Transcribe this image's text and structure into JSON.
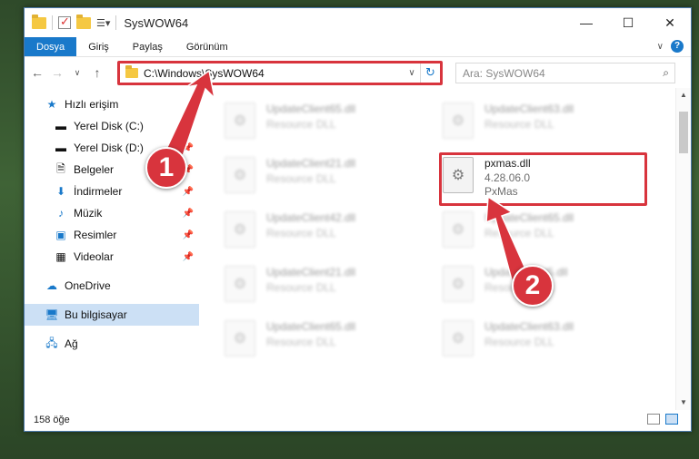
{
  "window": {
    "title": "SysWOW64",
    "caption_buttons": [
      "minimize-icon",
      "maximize-icon",
      "close-icon"
    ]
  },
  "ribbon": {
    "tabs": [
      {
        "label": "Dosya",
        "active": true
      },
      {
        "label": "Giriş",
        "active": false
      },
      {
        "label": "Paylaş",
        "active": false
      },
      {
        "label": "Görünüm",
        "active": false
      }
    ]
  },
  "address": {
    "path": "C:\\Windows\\SysWOW64",
    "search_placeholder": "Ara: SysWOW64"
  },
  "sidebar": {
    "items": [
      {
        "label": "Hızlı erişim",
        "icon": "star-icon",
        "pinned": false,
        "selected": false
      },
      {
        "label": "Yerel Disk (C:)",
        "icon": "drive-icon",
        "pinned": true,
        "selected": false
      },
      {
        "label": "Yerel Disk (D:)",
        "icon": "drive-icon",
        "pinned": true,
        "selected": false
      },
      {
        "label": "Belgeler",
        "icon": "documents-icon",
        "pinned": true,
        "selected": false
      },
      {
        "label": "İndirmeler",
        "icon": "download-icon",
        "pinned": true,
        "selected": false
      },
      {
        "label": "Müzik",
        "icon": "music-icon",
        "pinned": true,
        "selected": false
      },
      {
        "label": "Resimler",
        "icon": "pictures-icon",
        "pinned": true,
        "selected": false
      },
      {
        "label": "Videolar",
        "icon": "video-icon",
        "pinned": true,
        "selected": false
      },
      {
        "label": "OneDrive",
        "icon": "cloud-icon",
        "pinned": false,
        "selected": false
      },
      {
        "label": "Bu bilgisayar",
        "icon": "computer-icon",
        "pinned": false,
        "selected": true
      },
      {
        "label": "Ağ",
        "icon": "network-icon",
        "pinned": false,
        "selected": false
      }
    ]
  },
  "files": [
    {
      "name": "UpdateClient65.dll",
      "sub": "Resource DLL",
      "blurred": true
    },
    {
      "name": "UpdateClient63.dll",
      "sub": "Resource DLL",
      "blurred": true
    },
    {
      "name": "UpdateClient21.dll",
      "sub": "Resource DLL",
      "blurred": true
    },
    {
      "name": "pxmas.dll",
      "version": "4.28.06.0",
      "sub": "PxMas",
      "blurred": false
    },
    {
      "name": "UpdateClient42.dll",
      "sub": "Resource DLL",
      "blurred": true
    },
    {
      "name": "UpdateClient65.dll",
      "sub": "Resource DLL",
      "blurred": true
    },
    {
      "name": "UpdateClient21.dll",
      "sub": "Resource DLL",
      "blurred": true
    },
    {
      "name": "UpdateClient5.dll",
      "sub": "Resource DLL",
      "blurred": true
    },
    {
      "name": "UpdateClient65.dll",
      "sub": "Resource DLL",
      "blurred": true
    },
    {
      "name": "UpdateClient63.dll",
      "sub": "Resource DLL",
      "blurred": true
    }
  ],
  "status": {
    "count": "158 öğe"
  },
  "annotations": {
    "step1": "1",
    "step2": "2",
    "color": "#d8343d"
  }
}
